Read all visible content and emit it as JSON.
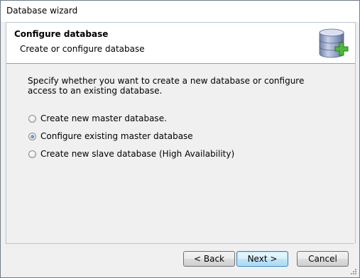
{
  "window": {
    "title": "Database wizard"
  },
  "header": {
    "title": "Configure database",
    "subtitle": "Create or configure database",
    "icon": "database-add-icon"
  },
  "main": {
    "instruction": "Specify whether you want to create a new database or configure access to an existing database.",
    "options": [
      {
        "label": "Create new master database.",
        "checked": false
      },
      {
        "label": "Configure existing master database",
        "checked": true
      },
      {
        "label": "Create new slave database (High Availability)",
        "checked": false
      }
    ]
  },
  "footer": {
    "back_label": "< Back",
    "next_label": "Next >",
    "cancel_label": "Cancel"
  },
  "colors": {
    "accent": "#3c7fb1",
    "db_icon": "#8e9fc3",
    "plus_icon": "#4db83a"
  }
}
